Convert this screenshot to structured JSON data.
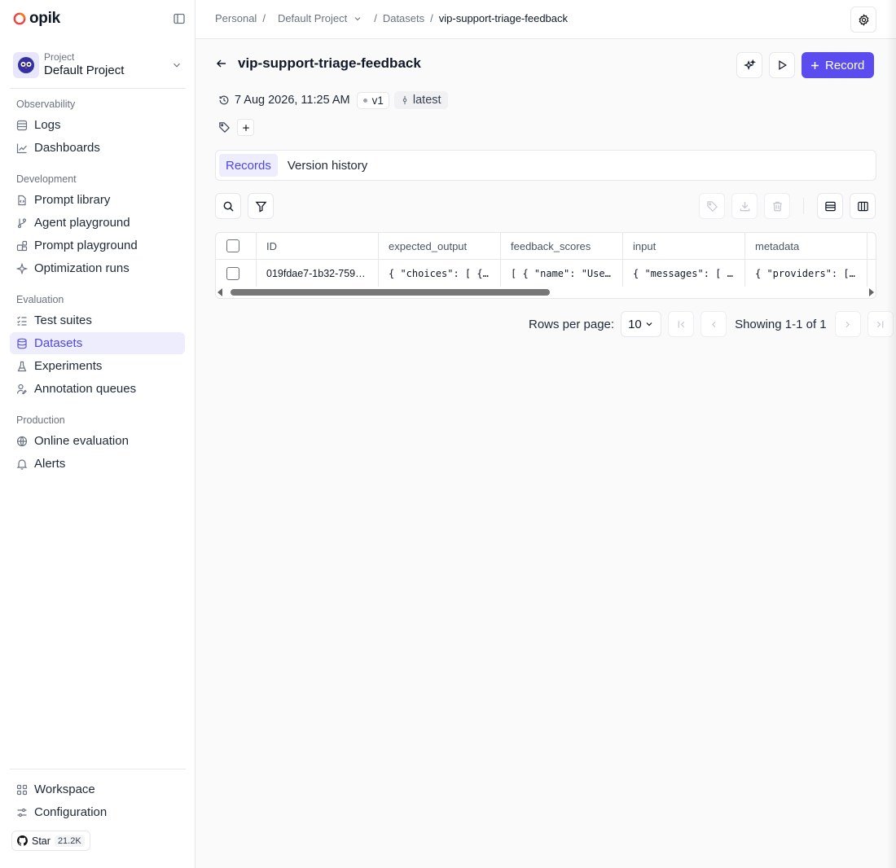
{
  "app": {
    "name": "opik"
  },
  "sidebar": {
    "project": {
      "label": "Project",
      "name": "Default Project"
    },
    "sections": [
      {
        "label": "Observability",
        "items": [
          {
            "label": "Logs",
            "icon": "list-icon"
          },
          {
            "label": "Dashboards",
            "icon": "chart-icon"
          }
        ]
      },
      {
        "label": "Development",
        "items": [
          {
            "label": "Prompt library",
            "icon": "file-code-icon"
          },
          {
            "label": "Agent playground",
            "icon": "git-branch-icon"
          },
          {
            "label": "Prompt playground",
            "icon": "blocks-icon"
          },
          {
            "label": "Optimization runs",
            "icon": "sparkles-icon"
          }
        ]
      },
      {
        "label": "Evaluation",
        "items": [
          {
            "label": "Test suites",
            "icon": "checklist-icon"
          },
          {
            "label": "Datasets",
            "icon": "database-icon",
            "active": true
          },
          {
            "label": "Experiments",
            "icon": "flask-icon"
          },
          {
            "label": "Annotation queues",
            "icon": "user-edit-icon"
          }
        ]
      },
      {
        "label": "Production",
        "items": [
          {
            "label": "Online evaluation",
            "icon": "globe-icon"
          },
          {
            "label": "Alerts",
            "icon": "bell-icon"
          }
        ]
      }
    ],
    "footer": [
      {
        "label": "Workspace",
        "icon": "grid-icon"
      },
      {
        "label": "Configuration",
        "icon": "sliders-icon"
      }
    ],
    "github": {
      "label": "Star",
      "count": "21.2K"
    }
  },
  "breadcrumb": {
    "workspace": "Personal",
    "project": "Default Project",
    "section": "Datasets",
    "current": "vip-support-triage-feedback"
  },
  "dataset": {
    "title": "vip-support-triage-feedback",
    "created": "7 Aug 2026, 11:25 AM",
    "version": "v1",
    "tag": "latest",
    "record_button": "Record"
  },
  "tabs": [
    {
      "label": "Records",
      "active": true
    },
    {
      "label": "Version history"
    }
  ],
  "table": {
    "columns": [
      "ID",
      "expected_output",
      "feedback_scores",
      "input",
      "metadata"
    ],
    "rows": [
      {
        "id": "019fdae7-1b32-759…",
        "expected_output": "{ \"choices\": [ {…",
        "feedback_scores": "[ { \"name\": \"Use…",
        "input": "{ \"messages\": [ …",
        "metadata": "{ \"providers\": […"
      }
    ]
  },
  "pagination": {
    "rows_per_page_label": "Rows per page:",
    "rows_per_page": "10",
    "showing": "Showing 1-1 of 1"
  },
  "colors": {
    "accent": "#5b4cf0",
    "active_bg": "#ededfd",
    "active_text": "#4f46e5"
  }
}
